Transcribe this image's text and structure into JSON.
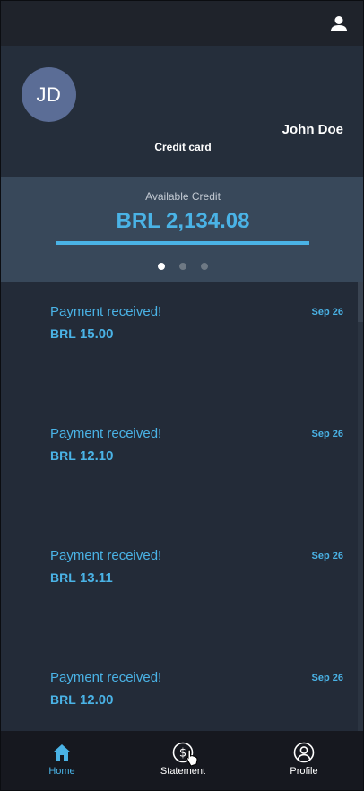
{
  "profile": {
    "initials": "JD",
    "name": "John Doe",
    "card_type": "Credit card"
  },
  "credit": {
    "label": "Available Credit",
    "amount": "BRL 2,134.08",
    "bar_fraction": 1.0
  },
  "carousel": {
    "pages": 3,
    "active": 0
  },
  "transactions": [
    {
      "title": "Payment received!",
      "currency": "BRL",
      "amount": "15.00",
      "date": "Sep 26"
    },
    {
      "title": "Payment received!",
      "currency": "BRL",
      "amount": "12.10",
      "date": "Sep 26"
    },
    {
      "title": "Payment received!",
      "currency": "BRL",
      "amount": "13.11",
      "date": "Sep 26"
    },
    {
      "title": "Payment received!",
      "currency": "BRL",
      "amount": "12.00",
      "date": "Sep 26"
    }
  ],
  "nav": {
    "home": "Home",
    "statement": "Statement",
    "profile": "Profile"
  },
  "colors": {
    "accent": "#4ab3e6",
    "avatar": "#5b6d96",
    "panel": "#38485a",
    "background": "#232b38"
  },
  "icons": {
    "top_right": "user-icon",
    "home": "home-icon",
    "statement": "dollar-circle-icon",
    "profile": "profile-icon"
  }
}
